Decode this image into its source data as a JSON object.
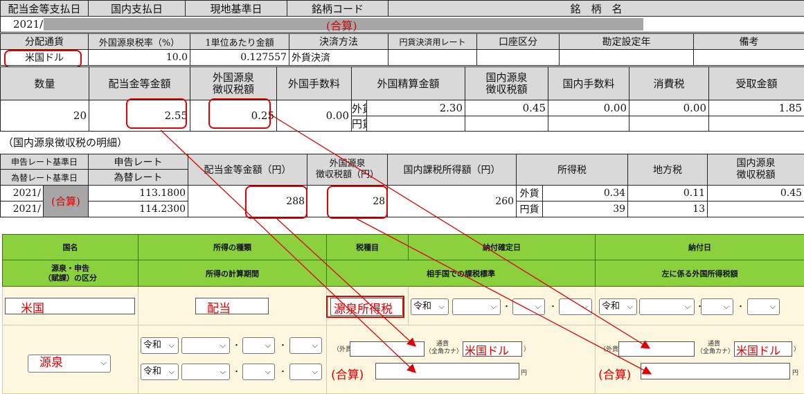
{
  "top_table": {
    "headers": [
      "配当金等支払日",
      "国内支払日",
      "現地基準日",
      "銘柄コード",
      "銘　柄　名"
    ],
    "year": "2021/",
    "stock_name_note": "(合算)"
  },
  "row2": {
    "headers": [
      "分配通貨",
      "外国源泉税率（%）",
      "1単位あたり金額",
      "決済方法",
      "円貨決済用レート",
      "口座区分",
      "勘定設定年",
      "備考"
    ],
    "values": {
      "currency": "米国ドル",
      "tax_rate": "10.0",
      "unit_amount": "0.127557",
      "settlement": "外貨決済"
    }
  },
  "amounts": {
    "headers": [
      "数量",
      "配当金等金額",
      "外国源泉\n徴収税額",
      "外国手数料",
      "外国精算金額",
      "国内源泉\n徴収税額",
      "国内手数料",
      "消費税",
      "受取金額"
    ],
    "quantity": "20",
    "dividend": "2.55",
    "foreign_tax": "0.25",
    "foreign_fee": "0.00",
    "fx_label": "外貨",
    "jpy_label": "円貨",
    "foreign_settle": "2.30",
    "domestic_tax": "0.45",
    "domestic_fee": "0.00",
    "consumption_tax": "0.00",
    "received": "1.85"
  },
  "detail": {
    "caption": "（国内源泉徴収税の明細）",
    "headers": [
      "申告レート基準日",
      "申告レート",
      "配当金等金額（円）",
      "外国源泉\n徴収税額（円）",
      "国内課税所得額（円）",
      "所得税",
      "地方税",
      "国内源泉\n徴収税額"
    ],
    "sub_headers": [
      "為替レート基準日",
      "為替レート"
    ],
    "year1": "2021/",
    "year2": "2021/",
    "merged_note": "(合算)",
    "rate1": "113.1800",
    "rate2": "114.2300",
    "dividend_yen": "288",
    "foreign_tax_yen": "28",
    "taxable_yen": "260",
    "fx_label": "外貨",
    "jpy_label": "円貨",
    "income_tax_fx": "0.34",
    "local_tax_fx": "0.11",
    "domestic_tax_fx": "0.45",
    "income_tax_jpy": "39",
    "local_tax_jpy": "13"
  },
  "form": {
    "headers": [
      "国名",
      "所得の種類",
      "税種目",
      "納付確定日",
      "納付日"
    ],
    "headers2": [
      "源泉・申告\n（賦課）の区分",
      "所得の計算期間",
      "相手国での課税標準",
      "左に係る外国所得税額"
    ],
    "country": "米国",
    "income_type": "配当",
    "tax_item": "源泉所得税",
    "era": "令和",
    "dot": "・",
    "withholding": "源泉",
    "fx_prefix": "（外貨",
    "currency_label": "通貨\n（全角カナ）",
    "currency_value": "米国ドル",
    "close_paren": "）",
    "combined": "(合算)",
    "yen": "円"
  },
  "colors": {
    "annotation_red": "#e00000",
    "header_green": "#8bd13d",
    "cell_cream": "#fdf7df",
    "header_gray": "#d9d9d9"
  }
}
